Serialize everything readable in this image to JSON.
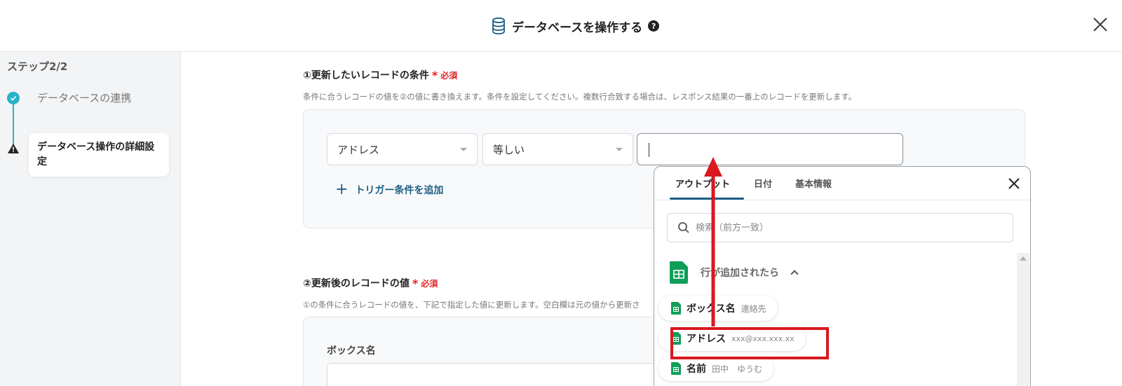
{
  "header": {
    "title": "データベースを操作する",
    "help_glyph": "?",
    "close_icon": "close-icon"
  },
  "sidebar": {
    "step_label": "ステップ2/2",
    "steps": [
      {
        "label": "データベースの連携",
        "status": "done"
      },
      {
        "label": "データベース操作の詳細設定",
        "status": "warning"
      }
    ]
  },
  "section1": {
    "title": "①更新したいレコードの条件",
    "required_mark": "*",
    "required_text": "必須",
    "description": "条件に合うレコードの値を②の値に書き換えます。条件を設定してください。複数行合致する場合は、レスポンス結果の一番上のレコードを更新します。",
    "field_select": "アドレス",
    "operator_select": "等しい",
    "value_input": "",
    "add_condition_plus": "+",
    "add_condition_label": "トリガー条件を追加"
  },
  "section2": {
    "title": "②更新後のレコードの値",
    "required_mark": "*",
    "required_text": "必須",
    "description": "①の条件に合うレコードの値を、下記で指定した値に更新します。空白欄は元の値から更新さ",
    "field_label": "ボックス名"
  },
  "popup": {
    "tabs": [
      {
        "label": "アウトプット",
        "active": true
      },
      {
        "label": "日付",
        "active": false
      },
      {
        "label": "基本情報",
        "active": false
      }
    ],
    "search_placeholder": "検索（前方一致）",
    "group_label": "行が追加されたら",
    "items": [
      {
        "name": "ボックス名",
        "value": "連絡先"
      },
      {
        "name": "アドレス",
        "value": "xxx@xxx.xxx.xx",
        "highlighted": true
      },
      {
        "name": "名前",
        "value": "田中　ゆうむ"
      }
    ]
  },
  "colors": {
    "accent_teal": "#29b2c7",
    "link_blue": "#1d5f86",
    "required_red": "#e02424",
    "annotation_red": "#d9181f",
    "sheets_green": "#0f9d58"
  }
}
